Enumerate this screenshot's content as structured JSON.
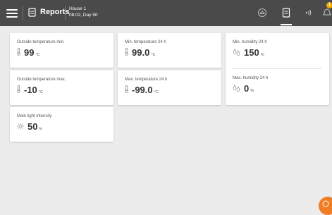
{
  "topbar": {
    "title": "Reports",
    "house": "House 1",
    "subtitle": "08:02, Day 50",
    "badge_count": "1",
    "icons": [
      "menu-icon",
      "report-icon",
      "house-settings-icon",
      "reports-nav-icon",
      "broadcast-icon",
      "alarm-icon"
    ]
  },
  "cards": {
    "outside_min": {
      "label": "Outside temperature min.",
      "value": "99",
      "unit": "°C",
      "icon": "thermometer-icon"
    },
    "outside_max": {
      "label": "Outside temperature max.",
      "value": "-10",
      "unit": "°C",
      "icon": "thermometer-icon"
    },
    "light": {
      "label": "Main light intensity",
      "value": "50",
      "unit": "lx",
      "icon": "light-icon"
    },
    "temp_min": {
      "label": "Min. temperature 24 h",
      "value": "99.0",
      "unit": "°C",
      "icon": "thermometer-icon"
    },
    "temp_max": {
      "label": "Max. temperature 24 h",
      "value": "-99.0",
      "unit": "°C",
      "icon": "thermometer-icon"
    },
    "hum_min": {
      "label": "Min. humidity 24 h",
      "value": "150",
      "unit": "%",
      "icon": "humidity-icon"
    },
    "hum_max": {
      "label": "Max. humidity 24 h",
      "value": "0",
      "unit": "%",
      "icon": "humidity-icon"
    }
  },
  "colors": {
    "topbar": "#4a4a4a",
    "background": "#ececec",
    "accent": "#f07d26",
    "badge": "#f2a900"
  }
}
